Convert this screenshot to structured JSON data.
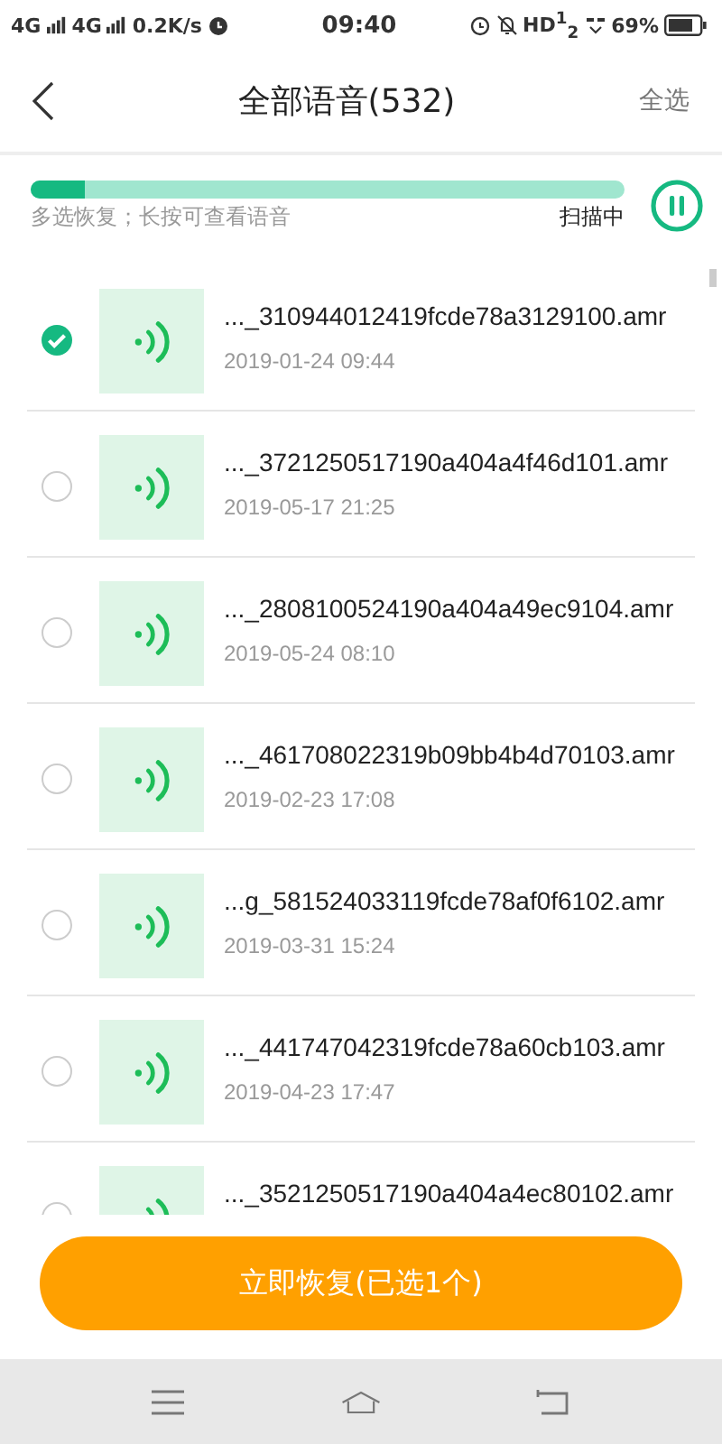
{
  "status_bar": {
    "left": [
      "4G",
      "4G",
      "0.2K/s"
    ],
    "time": "09:40",
    "hd": "HD$^{1}$$_{2}$",
    "battery": "69%"
  },
  "header": {
    "title": "全部语音(532)",
    "action": "全选"
  },
  "scan": {
    "level": 0.09,
    "hint": "多选恢复；长按可查看语音",
    "status": "扫描中"
  },
  "files": [
    {
      "name": "..._310944012419fcde78a3129100.amr",
      "date": "2019-01-24 09:44",
      "selected": true
    },
    {
      "name": "..._3721250517190a404a4f46d101.amr",
      "date": "2019-05-17 21:25",
      "selected": false
    },
    {
      "name": "..._2808100524190a404a49ec9104.amr",
      "date": "2019-05-24 08:10",
      "selected": false
    },
    {
      "name": "..._461708022319b09bb4b4d70103.amr",
      "date": "2019-02-23 17:08",
      "selected": false
    },
    {
      "name": "...g_581524033119fcde78af0f6102.amr",
      "date": "2019-03-31 15:24",
      "selected": false
    },
    {
      "name": "..._441747042319fcde78a60cb103.amr",
      "date": "2019-04-23 17:47",
      "selected": false
    },
    {
      "name": "..._3521250517190a404a4ec80102.amr",
      "selected": false
    }
  ],
  "restore_button": "立即恢复(已选1个)"
}
